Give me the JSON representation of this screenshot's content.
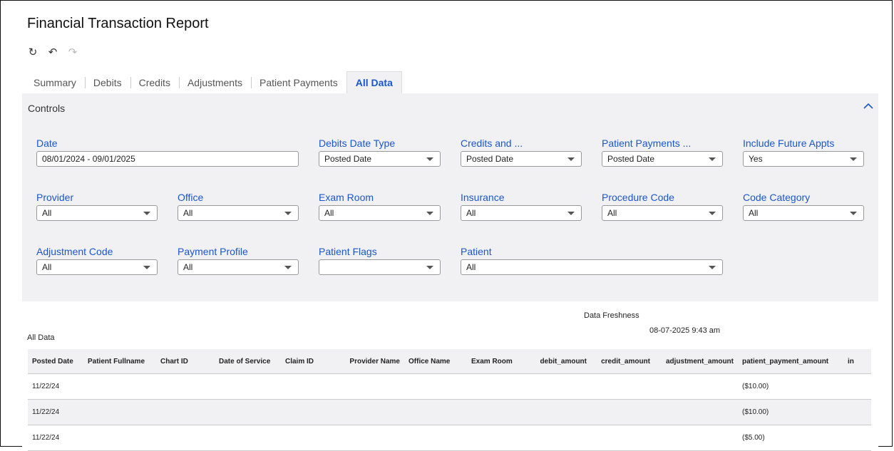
{
  "report": {
    "title": "Financial Transaction Report"
  },
  "toolbar": {
    "icons": [
      "reset-icon",
      "undo-icon",
      "redo-icon"
    ]
  },
  "tabs": [
    {
      "label": "Summary"
    },
    {
      "label": "Debits"
    },
    {
      "label": "Credits"
    },
    {
      "label": "Adjustments"
    },
    {
      "label": "Patient Payments"
    },
    {
      "label": "All Data",
      "active": true
    }
  ],
  "controls": {
    "title": "Controls",
    "filters": {
      "date": {
        "label": "Date",
        "value": "08/01/2024 - 09/01/2025"
      },
      "debits_date_type": {
        "label": "Debits Date Type",
        "value": "Posted Date"
      },
      "credits_and": {
        "label": "Credits and ...",
        "value": "Posted Date"
      },
      "patient_payments": {
        "label": "Patient Payments ...",
        "value": "Posted Date"
      },
      "include_future": {
        "label": "Include Future Appts",
        "value": "Yes"
      },
      "provider": {
        "label": "Provider",
        "value": "All"
      },
      "office": {
        "label": "Office",
        "value": "All"
      },
      "exam_room": {
        "label": "Exam Room",
        "value": "All"
      },
      "insurance": {
        "label": "Insurance",
        "value": "All"
      },
      "procedure_code": {
        "label": "Procedure Code",
        "value": "All"
      },
      "code_category": {
        "label": "Code Category",
        "value": "All"
      },
      "adjustment_code": {
        "label": "Adjustment Code",
        "value": "All"
      },
      "payment_profile": {
        "label": "Payment Profile",
        "value": "All"
      },
      "patient_flags": {
        "label": "Patient Flags",
        "value": ""
      },
      "patient": {
        "label": "Patient",
        "value": "All"
      }
    }
  },
  "freshness": {
    "label": "Data Freshness",
    "value": "08-07-2025 9:43 am"
  },
  "table": {
    "caption": "All Data",
    "columns": [
      "Posted Date",
      "Patient Fullname",
      "Chart ID",
      "Date of Service",
      "Claim ID",
      "Provider Name",
      "Office Name",
      "Exam Room",
      "debit_amount",
      "credit_amount",
      "adjustment_amount",
      "patient_payment_amount",
      "in"
    ],
    "rows": [
      {
        "posted_date": "11/22/24",
        "patient_payment_amount": "($10.00)"
      },
      {
        "posted_date": "11/22/24",
        "patient_payment_amount": "($10.00)"
      },
      {
        "posted_date": "11/22/24",
        "patient_payment_amount": "($5.00)"
      }
    ]
  }
}
